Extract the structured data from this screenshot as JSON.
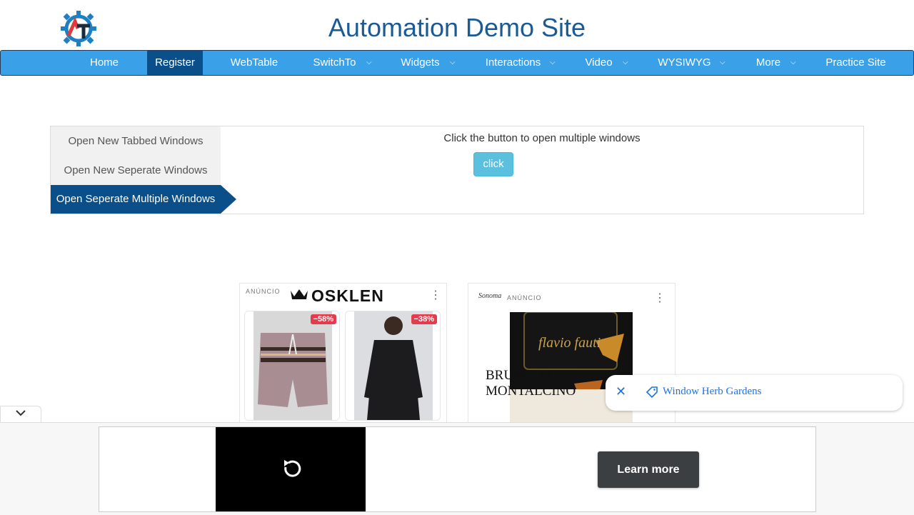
{
  "header": {
    "site_title": "Automation Demo Site",
    "logo_letters": "AT"
  },
  "nav": [
    {
      "label": "Home",
      "dropdown": false,
      "active": false
    },
    {
      "label": "Register",
      "dropdown": false,
      "active": true
    },
    {
      "label": "WebTable",
      "dropdown": false,
      "active": false
    },
    {
      "label": "SwitchTo",
      "dropdown": true,
      "active": false
    },
    {
      "label": "Widgets",
      "dropdown": true,
      "active": false
    },
    {
      "label": "Interactions",
      "dropdown": true,
      "active": false
    },
    {
      "label": "Video",
      "dropdown": true,
      "active": false
    },
    {
      "label": "WYSIWYG",
      "dropdown": true,
      "active": false
    },
    {
      "label": "More",
      "dropdown": true,
      "active": false
    },
    {
      "label": "Practice Site",
      "dropdown": false,
      "active": false
    }
  ],
  "tabs": [
    {
      "label": "Open New Tabbed Windows",
      "active": false
    },
    {
      "label": "Open New Seperate Windows",
      "active": false
    },
    {
      "label": "Open Seperate Multiple Windows",
      "active": true
    }
  ],
  "panel": {
    "instruction": "Click the button to open multiple windows",
    "button_label": "click"
  },
  "ads": {
    "osklen": {
      "ad_label": "ANÚNCIO",
      "brand": "OSKLEN",
      "products": [
        {
          "discount": "−58%",
          "item": "shorts"
        },
        {
          "discount": "−38%",
          "item": "long-sleeve shirt"
        }
      ]
    },
    "sonoma": {
      "brand": "Sonoma",
      "ad_label": "ANÚNCIO",
      "wine_label": "BRUNELLO DI MONTALCINO",
      "signature": "flavio fauti"
    },
    "suggestion_chip": {
      "text": "Window Herb Gardens"
    },
    "bottom_banner": {
      "learn_more": "Learn more"
    }
  },
  "colors": {
    "title": "#1a5a96",
    "nav_bg": "#3aa0e8",
    "nav_active": "#0a4f8a",
    "button": "#5bc0de",
    "discount": "#e43b4d",
    "chip_text": "#1a73e8"
  },
  "icons": [
    "logo-gear-icon",
    "chevron-down-icon",
    "kebab-menu-icon",
    "crown-icon",
    "close-icon",
    "tag-icon",
    "replay-icon",
    "collapse-chevron-icon"
  ]
}
